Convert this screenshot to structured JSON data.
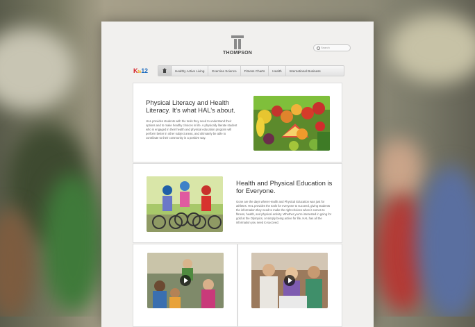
{
  "brand": {
    "logo_text": "THOMPSON"
  },
  "search": {
    "placeholder": "Search"
  },
  "k12_logo": {
    "k": "K",
    "to": "to",
    "num": "12"
  },
  "nav": {
    "items": [
      {
        "label": "Healthy Active Living"
      },
      {
        "label": "Exercise Science"
      },
      {
        "label": "Fitness Charts"
      },
      {
        "label": "Health"
      },
      {
        "label": "International Business"
      }
    ]
  },
  "section1": {
    "heading": "Physical Literacy and Health Literacy. It’s what HAL’s about.",
    "body": "HAL provides students with the tools they need to understand their options and to make healthy choices in life. A physically literate student who is engaged in their health and physical education program will perform better in other subject areas, and ultimately be able to contribute to their community in a positive way."
  },
  "section2": {
    "heading": "Health and Physical Education is for Everyone.",
    "body": "Gone are the days where Health and Physical Education was just for athletes. HAL provides the tools for everyone to succeed, giving students the information they need to make the right choices when it comes to fitness, health, and physical activity. Whether you're interested in going for gold at the Olympics, or simply being active for life, HAL has all the information you need to succeed."
  },
  "colors": {
    "k_red": "#d6252b",
    "to_yellow": "#e9a81b",
    "twelve_blue": "#1c6bbf"
  }
}
